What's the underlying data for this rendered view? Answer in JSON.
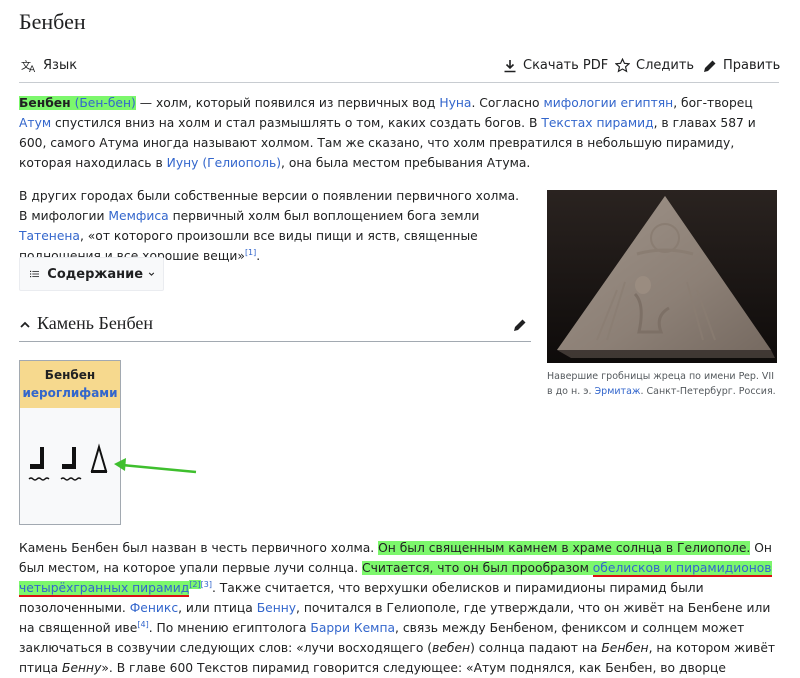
{
  "page": {
    "title": "Бенбен"
  },
  "toolbar": {
    "language": "Язык",
    "download_pdf": "Скачать PDF",
    "watch": "Следить",
    "edit": "Править"
  },
  "intro": {
    "term": "Бенбен",
    "alt": "(Бен-бен)",
    "t1": " — холм, который появился из первичных вод ",
    "link_nun": "Нуна",
    "t2": ". Согласно ",
    "link_myth": "мифологии египтян",
    "t3": ", бог-творец ",
    "link_atum": "Атум",
    "t4": " спустился вниз на холм и стал размышлять о том, каких создать богов. В ",
    "link_texts": "Текстах пирамид",
    "t5": ", в главах 587 и 600, самого Атума иногда называют холмом. Там же сказано, что холм превратился в небольшую пирамиду, которая находилась в ",
    "link_iunu": "Иуну (Гелиополь)",
    "t6": ", она была местом пребывания Атума."
  },
  "para2": {
    "t1": "В других городах были собственные версии о появлении первичного холма. В мифологии ",
    "link_memphis": "Мемфиса",
    "t2": " первичный холм был воплощением бога земли ",
    "link_tatenen": "Татенена",
    "t3": ", «от которого произошли все виды пищи и яств, священные подношения и все хорошие вещи»",
    "ref1": "[1]",
    "t4": "."
  },
  "toc": {
    "label": "Содержание"
  },
  "section": {
    "title": "Камень Бенбен"
  },
  "infobox": {
    "name": "Бенбен",
    "link": "иероглифами"
  },
  "figure": {
    "caption_t1": "Навершие гробницы жреца по имени Pep. VII в до н. э. ",
    "caption_link": "Эрмитаж",
    "caption_t2": ". Санкт-Петербург. Россия."
  },
  "para3": {
    "t1": "Камень Бенбен был назван в честь первичного холма. ",
    "hl1": "Он был священным камнем в храме солнца в Гелиополе.",
    "t2": " Он был местом, на которое упали первые лучи солнца. ",
    "hl2": "Считается, что он был прообразом ",
    "hl2_link": "обелисков и пирамидионов четырёхгранных пирамид",
    "ref2": "[2]",
    "ref3": "[3]",
    "t3": ". Также считается, что верхушки обелисков и пирамидионы пирамид были позолоченными. ",
    "link_phoenix": "Феникс",
    "t4": ", или птица ",
    "link_bennu": "Бенну",
    "t5": ", почитался в Гелиополе, где утверждали, что он живёт на Бенбене или на священной иве",
    "ref4": "[4]",
    "t6": ". По мнению египтолога ",
    "link_kemp": "Барри Кемпа",
    "t7": ", связь между Бенбеном, фениксом и солнцем может заключаться в созвучии следующих слов: «лучи восходящего (",
    "i1": "вебен",
    "t8": ") солнца падают на ",
    "i2": "Бенбен",
    "t9": ", на котором живёт птица ",
    "i3": "Бенну",
    "t10": "». В главе 600 Текстов пирамид говорится следующее: «Атум поднялся, как Бенбен, во дворце"
  },
  "colors": {
    "link": "#3366cc",
    "highlight": "#7cf76c",
    "infobox_header": "#f6d98e",
    "arrow": "#3fbf2e",
    "underline": "#dd1111"
  }
}
